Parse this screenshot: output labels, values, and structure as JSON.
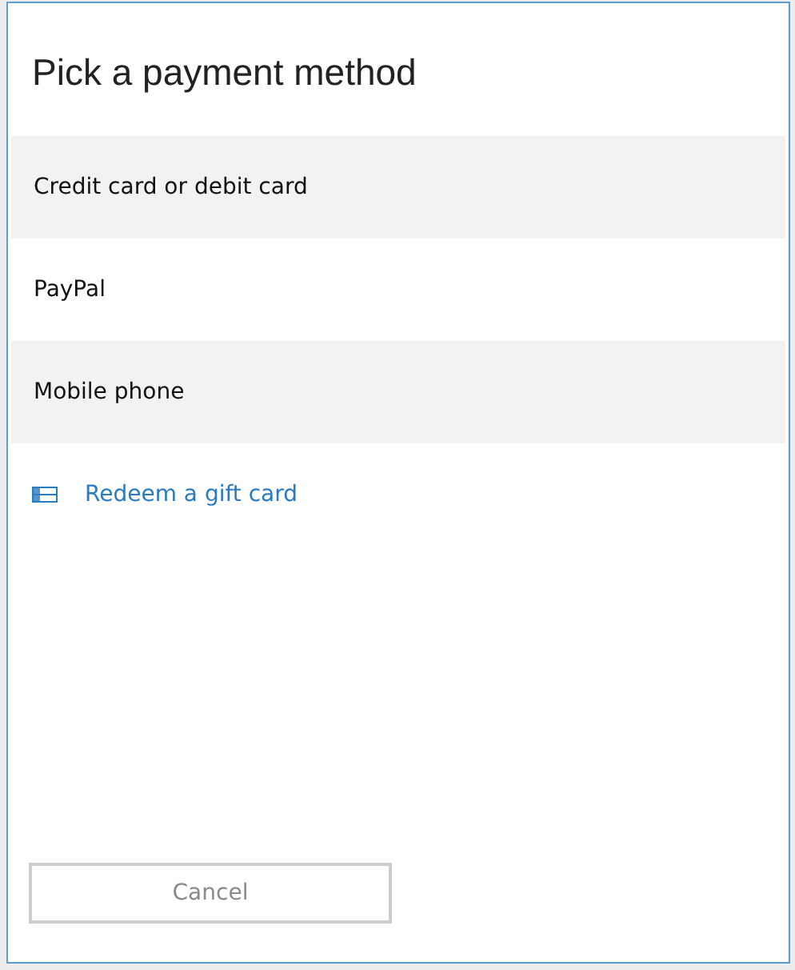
{
  "dialog": {
    "title": "Pick a payment method"
  },
  "options": [
    {
      "label": "Credit card or debit card"
    },
    {
      "label": "PayPal"
    },
    {
      "label": "Mobile phone"
    }
  ],
  "link": {
    "label": "Redeem a gift card"
  },
  "buttons": [
    {
      "label": "Cancel",
      "disabled": true
    }
  ]
}
